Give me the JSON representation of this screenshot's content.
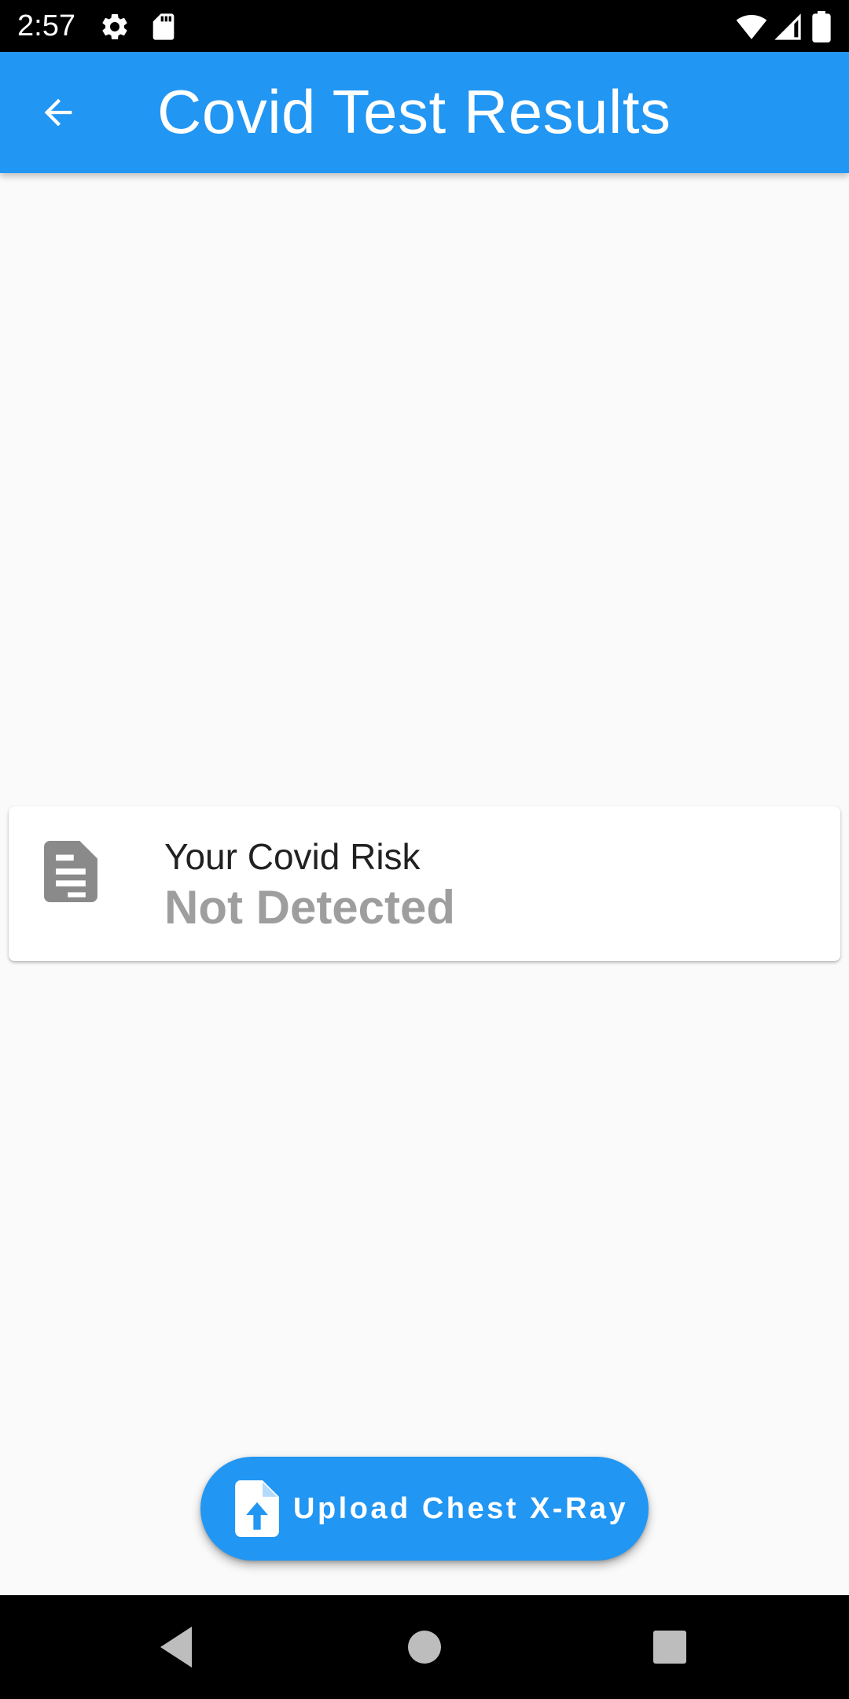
{
  "status_bar": {
    "time": "2:57",
    "icons": [
      "settings-icon",
      "sd-card-icon",
      "wifi-icon",
      "cell-signal-icon",
      "battery-icon"
    ]
  },
  "app_bar": {
    "title": "Covid Test Results",
    "back_icon": "arrow-back-icon",
    "color": "#2196f3"
  },
  "result_card": {
    "icon": "document-icon",
    "title": "Your Covid Risk",
    "value": "Not Detected",
    "value_color": "#9e9e9e"
  },
  "upload_button": {
    "icon": "file-upload-icon",
    "label": "Upload Chest X-Ray",
    "color": "#2196f3"
  },
  "nav_bar": {
    "buttons": [
      "back-triangle-icon",
      "home-circle-icon",
      "recents-square-icon"
    ]
  }
}
